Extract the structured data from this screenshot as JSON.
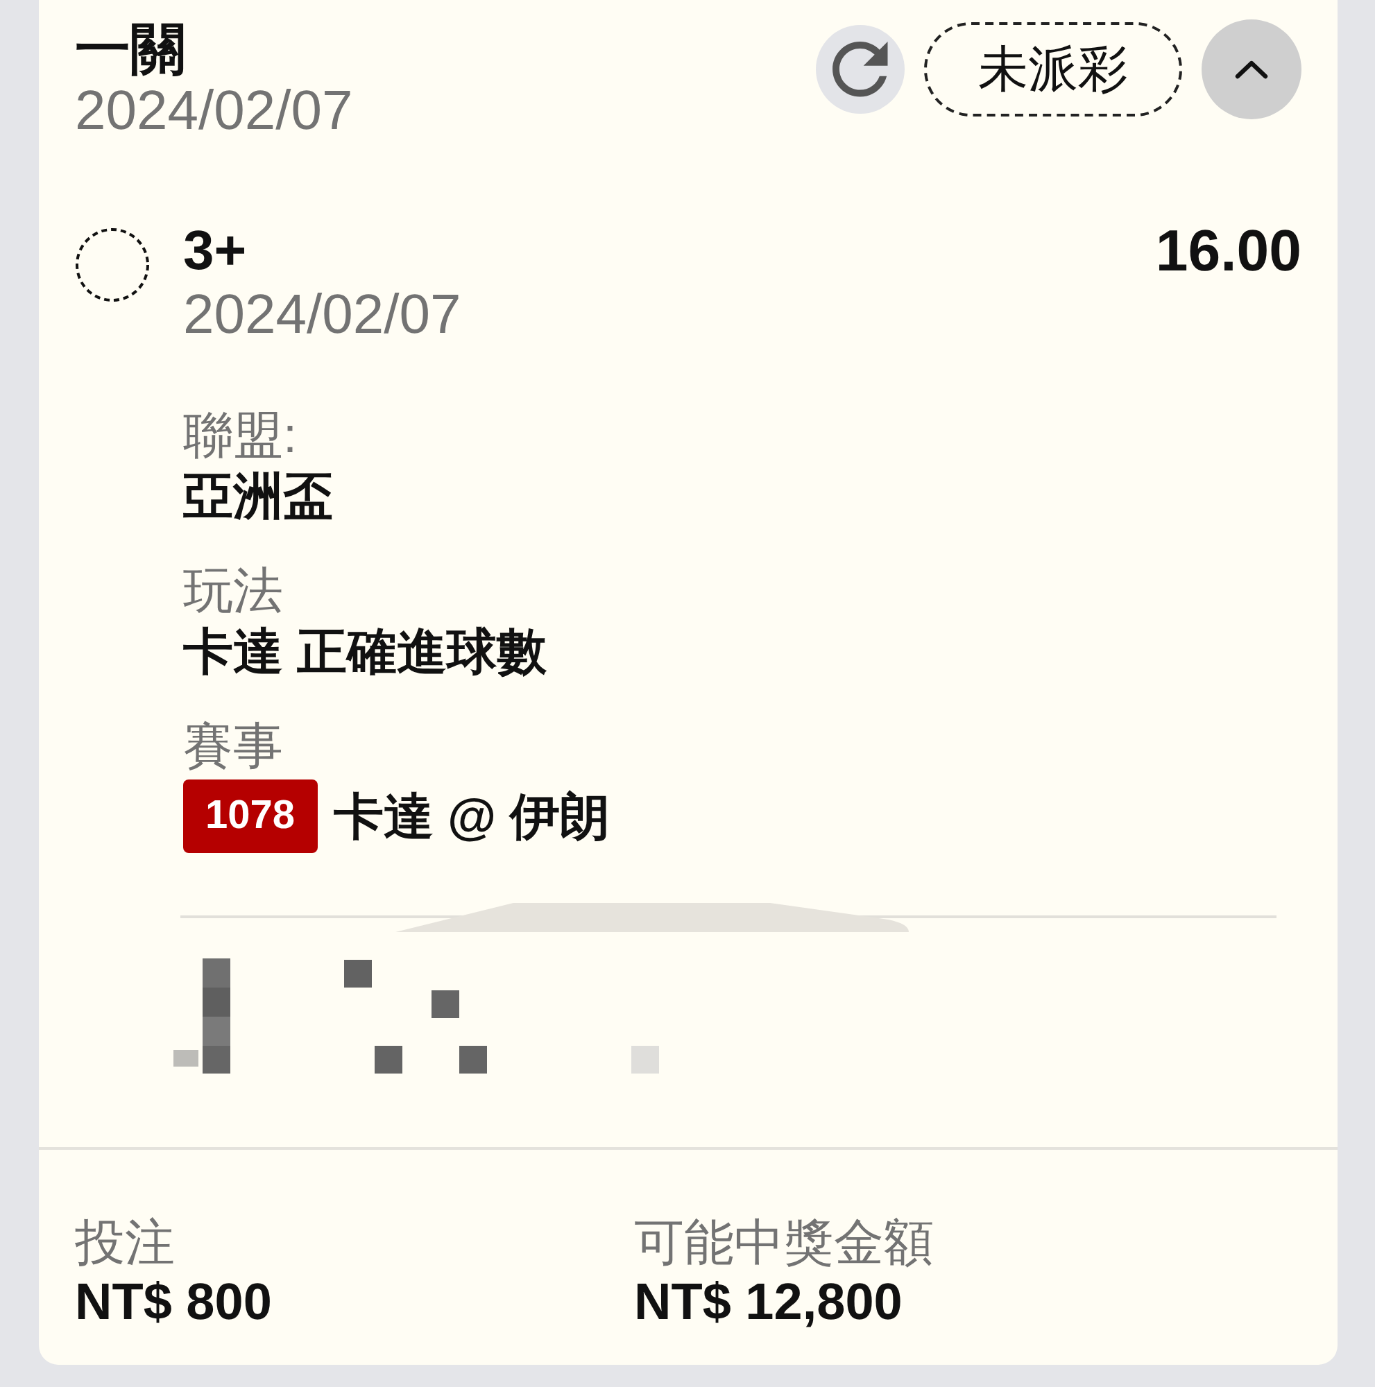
{
  "bet": {
    "type": "一關",
    "date": "2024/02/07",
    "status": "未派彩",
    "expanded": true
  },
  "selection": {
    "pick": "3+",
    "date": "2024/02/07",
    "odds": "16.00",
    "details": [
      {
        "kind": "text",
        "label": "聯盟:",
        "value": "亞洲盃"
      },
      {
        "kind": "text",
        "label": "玩法",
        "value": "卡達 正確進球數"
      },
      {
        "kind": "match",
        "label": "賽事",
        "match_number": "1078",
        "value": "卡達 @ 伊朗"
      }
    ]
  },
  "summary": [
    {
      "label": "投注",
      "value": "NT$ 800"
    },
    {
      "label": "可能中獎金額",
      "value": "NT$ 12,800"
    }
  ]
}
